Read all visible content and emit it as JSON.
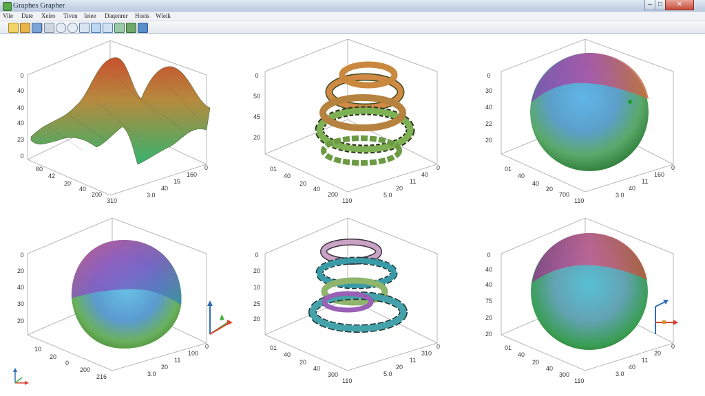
{
  "window": {
    "title": "Graphes Grapher",
    "controls": {
      "minimize": "–",
      "maximize": "□",
      "close": "✕"
    }
  },
  "menu": [
    "Vile",
    "Date",
    "Xeiro",
    "Tiven",
    "Ieiee",
    "Daqenrer",
    "Hoeis",
    "Wleik"
  ],
  "toolbar": {
    "icons": [
      "pointer-tool-icon",
      "open-folder-icon",
      "save-icon",
      "print-icon",
      "zoom-in-icon",
      "zoom-out-icon",
      "pan-icon",
      "rotate-icon",
      "fit-view-icon",
      "export-image-icon",
      "chart-icon",
      "view-3d-icon"
    ]
  },
  "colors": {
    "accent": "#2f6fb6",
    "axis-arrow-x": "#d8432f",
    "axis-arrow-y": "#3fae3f",
    "axis-arrow-z": "#2f6fb6"
  },
  "plots": [
    {
      "name": "peaks",
      "z_ticks": [
        "0",
        "40",
        "40",
        "40",
        "23",
        "0"
      ],
      "left_ticks": [
        "60",
        "42",
        "20",
        "40",
        "200",
        "310"
      ],
      "right_ticks": [
        "0",
        "160",
        "15",
        "40",
        "3.0"
      ]
    },
    {
      "name": "helix-orange-green",
      "z_ticks": [
        "0",
        "50",
        "45",
        "20"
      ],
      "left_ticks": [
        "01",
        "40",
        "20",
        "40",
        "200",
        "110"
      ],
      "right_ticks": [
        "0",
        "40",
        "11",
        "20",
        "5.0"
      ]
    },
    {
      "name": "sphere-right-top",
      "z_ticks": [
        "0",
        "30",
        "40",
        "22",
        "20"
      ],
      "left_ticks": [
        "01",
        "40",
        "40",
        "20",
        "700",
        "110"
      ],
      "right_ticks": [
        "0",
        "160",
        "11",
        "40",
        "3.0"
      ]
    },
    {
      "name": "sphere-left-bottom",
      "z_ticks": [
        "0",
        "20",
        "40",
        "30",
        "20"
      ],
      "left_ticks": [
        "10",
        "20",
        "0",
        "200",
        "216"
      ],
      "right_ticks": [
        "0",
        "100",
        "11",
        "20",
        "3.0"
      ]
    },
    {
      "name": "helix-pink-teal",
      "z_ticks": [
        "0",
        "20",
        "10",
        "25",
        "20"
      ],
      "left_ticks": [
        "01",
        "40",
        "20",
        "40",
        "300",
        "110"
      ],
      "right_ticks": [
        "0",
        "310",
        "11",
        "20",
        "5.0"
      ]
    },
    {
      "name": "sphere-right-bottom",
      "z_ticks": [
        "0",
        "40",
        "40",
        "75",
        "20",
        "20"
      ],
      "left_ticks": [
        "01",
        "40",
        "20",
        "40",
        "300",
        "110"
      ],
      "right_ticks": [
        "0",
        "20",
        "11",
        "40",
        "3.0"
      ]
    }
  ]
}
